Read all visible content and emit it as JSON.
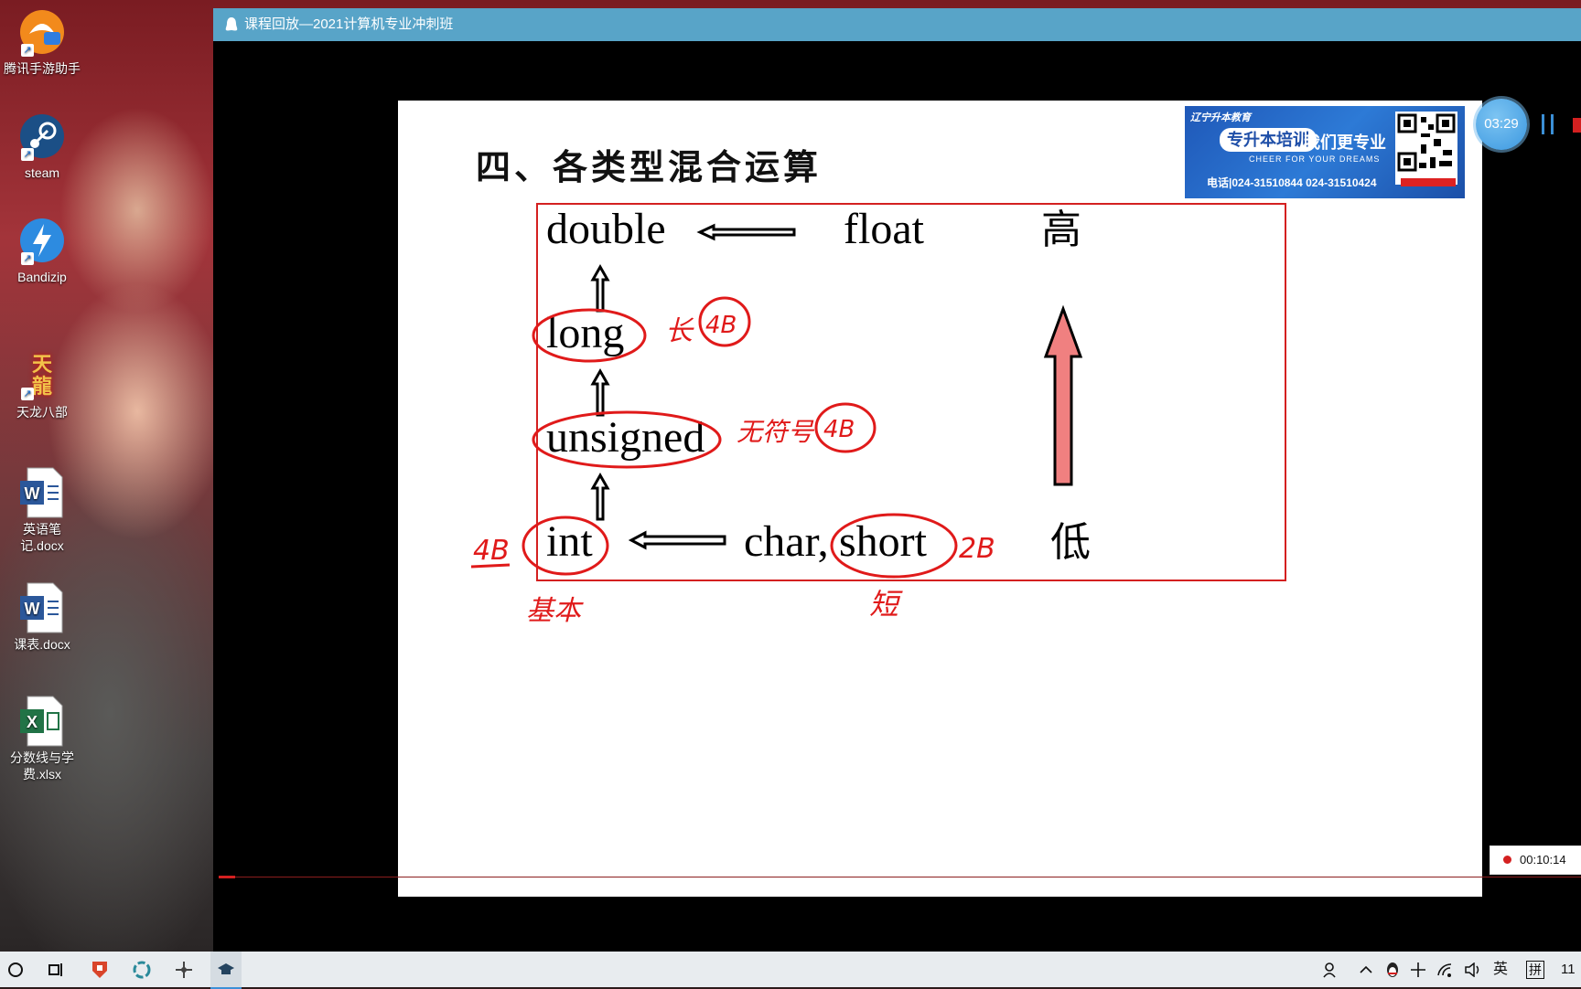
{
  "desktop": {
    "icons": [
      {
        "label": "腾讯手游助手",
        "icon": "tencent-game-icon",
        "color": "#f28a1c"
      },
      {
        "label": "steam",
        "icon": "steam-icon",
        "color": "#1b4f86"
      },
      {
        "label": "Bandizip",
        "icon": "bandizip-icon",
        "color": "#2d8be0"
      },
      {
        "label": "天龙八部",
        "icon": "tianlong-game-icon",
        "color": "#b8201c"
      },
      {
        "label": "英语笔记.docx",
        "icon": "word-doc-icon",
        "color": "#2b579a"
      },
      {
        "label": "课表.docx",
        "icon": "word-doc-icon",
        "color": "#2b579a"
      },
      {
        "label": "分数线与学费.xlsx",
        "icon": "excel-doc-icon",
        "color": "#217346"
      }
    ],
    "icon_glyphs": {
      "word": "W",
      "excel": "X",
      "tianlong": "天龍",
      "shortcut": "↗"
    }
  },
  "window": {
    "title": "课程回放—2021计算机专业冲刺班"
  },
  "player": {
    "countdown": "03:29",
    "recording_time": "00:10:14",
    "progress_fraction": 0.012
  },
  "banner": {
    "logo": "辽宁升本教育",
    "headline": "专升本培训",
    "headline2": "我们更专业",
    "subtitle": "CHEER FOR YOUR DREAMS",
    "phone": "电话|024-31510844 024-31510424"
  },
  "slide": {
    "title": "四、各类型混合运算",
    "types": {
      "double": "double",
      "float": "float",
      "long": "long",
      "unsigned": "unsigned",
      "int": "int",
      "char_short_prefix": "char,",
      "short": "short"
    },
    "high_label": "高",
    "low_label": "低",
    "annotations": {
      "long_note": "长",
      "long_size": "4B",
      "unsigned_note": "无符号",
      "unsigned_size": "4B",
      "int_size": "4B",
      "int_note": "基本",
      "short_size": "2B",
      "short_note": "短"
    },
    "colors": {
      "box": "#d42020",
      "ink": "#e01a1a",
      "rise_arrow": "#f08080"
    }
  },
  "taskbar": {
    "ime_lang": "英",
    "ime_mode": "拼",
    "clock": "11"
  }
}
